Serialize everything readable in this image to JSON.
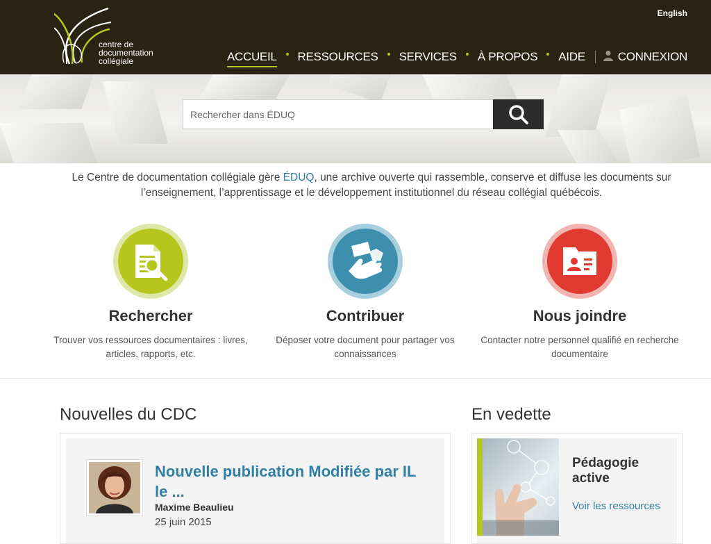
{
  "header": {
    "logo_lines": [
      "centre de",
      "documentation",
      "collégiale"
    ],
    "language_link": "English",
    "nav": [
      {
        "label": "ACCUEIL",
        "active": true
      },
      {
        "label": "RESSOURCES",
        "active": false
      },
      {
        "label": "SERVICES",
        "active": false
      },
      {
        "label": "À PROPOS",
        "active": false
      },
      {
        "label": "AIDE",
        "active": false
      }
    ],
    "login_label": "CONNEXION"
  },
  "search": {
    "placeholder": "Rechercher dans ÉDUQ",
    "button_icon": "search-icon"
  },
  "intro": {
    "before": "Le Centre de documentation collégiale gère ",
    "link": "ÉDUQ",
    "after": ", une archive ouverte qui rassemble, conserve et diffuse les documents sur l’enseignement, l’apprentissage et le développement institutionnel du réseau collégial québécois."
  },
  "features": [
    {
      "title": "Rechercher",
      "description": "Trouver vos ressources documentaires : livres, articles, rapports, etc.",
      "icon": "document-search-icon",
      "color": "#b6c61d"
    },
    {
      "title": "Contribuer",
      "description": "Déposer votre document pour partager vos connaissances",
      "icon": "hand-document-icon",
      "color": "#3d8fae"
    },
    {
      "title": "Nous joindre",
      "description": "Contacter notre personnel qualifié en recherche documentaire",
      "icon": "contact-card-icon",
      "color": "#e03a31"
    }
  ],
  "news": {
    "section_title": "Nouvelles du CDC",
    "item": {
      "title": "Nouvelle publication Modifiée par IL le ...",
      "author": "Maxime Beaulieu",
      "date": "25 juin 2015"
    }
  },
  "featured": {
    "section_title": "En vedette",
    "title": "Pédagogie active",
    "link": "Voir les ressources"
  },
  "colors": {
    "header_bg": "#2a2213",
    "accent_green": "#b6c61d",
    "link_blue": "#2f7fa4"
  }
}
